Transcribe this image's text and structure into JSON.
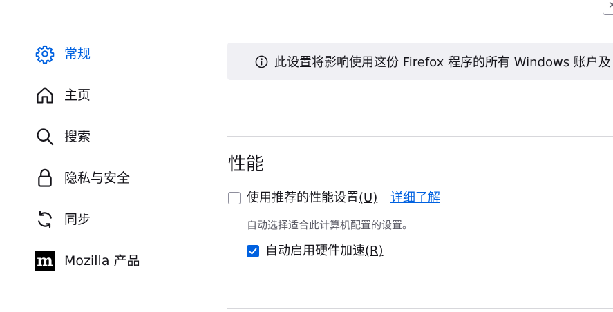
{
  "sidebar": {
    "items": [
      {
        "label": "常规",
        "icon": "gear-icon",
        "selected": true
      },
      {
        "label": "主页",
        "icon": "home-icon"
      },
      {
        "label": "搜索",
        "icon": "search-icon"
      },
      {
        "label": "隐私与安全",
        "icon": "lock-icon"
      },
      {
        "label": "同步",
        "icon": "sync-icon"
      },
      {
        "label": "Mozilla 产品",
        "icon": "mozilla-icon"
      }
    ]
  },
  "banner": {
    "text": "此设置将影响使用这份 Firefox 程序的所有 Windows 账户及"
  },
  "performance": {
    "title": "性能",
    "recommended_label": "使用推荐的性能设置",
    "recommended_accesskey": "(U)",
    "recommended_checked": false,
    "learn_more": "详细了解",
    "description": "自动选择适合此计算机配置的设置。",
    "hw_accel_label": "自动启用硬件加速",
    "hw_accel_accesskey": "(R)",
    "hw_accel_checked": true
  },
  "colors": {
    "accent": "#0061e0",
    "text": "#15141a",
    "secondary_text": "#5b5b66",
    "banner_bg": "#f0f0f4"
  }
}
